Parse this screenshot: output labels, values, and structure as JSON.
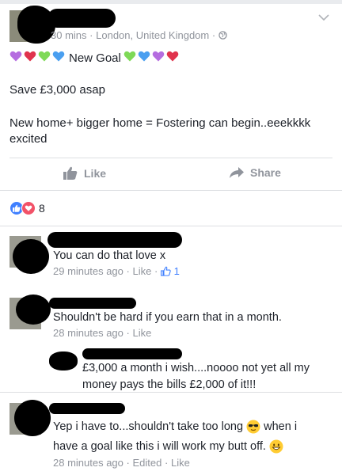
{
  "post": {
    "meta_time": "30 mins",
    "meta_sep1": "·",
    "meta_location": "London, United Kingdom",
    "meta_sep2": "·",
    "title": "New Goal",
    "line1": "Save £3,000 asap",
    "line2": "New home+ bigger home = Fostering can begin..eeekkkk excited",
    "hearts_before": [
      "purple",
      "red",
      "green",
      "blue"
    ],
    "hearts_after": [
      "green",
      "blue",
      "purple",
      "red"
    ]
  },
  "actions": {
    "like_label": "Like",
    "share_label": "Share"
  },
  "reactions": {
    "count": "8",
    "types": [
      "like",
      "love"
    ]
  },
  "comments": [
    {
      "text": "You can do that love x",
      "time": "29 minutes ago",
      "sep": "·",
      "like": "Like",
      "sep2": "·",
      "like_count": "1"
    },
    {
      "text": "Shouldn't be hard if you earn that in a month.",
      "time": "28 minutes ago",
      "sep": "·",
      "like": "Like"
    },
    {
      "text": "£3,000 a month i wish....noooo not yet all my money pays the bills £2,000 of it!!!"
    },
    {
      "text_a": "Yep i have to...shouldn't take too long",
      "text_b": "when i have a goal like this i will work my butt off.",
      "time": "28 minutes ago",
      "sep": "·",
      "edited": "Edited",
      "sep2": "·",
      "like": "Like"
    }
  ],
  "colors": {
    "heart_purple": "#b56de0",
    "heart_red": "#e0334d",
    "heart_green": "#7ed957",
    "heart_blue": "#4a9ff0",
    "fb_blue": "#4080ff",
    "love_red": "#f25268",
    "muted": "#90949c"
  }
}
